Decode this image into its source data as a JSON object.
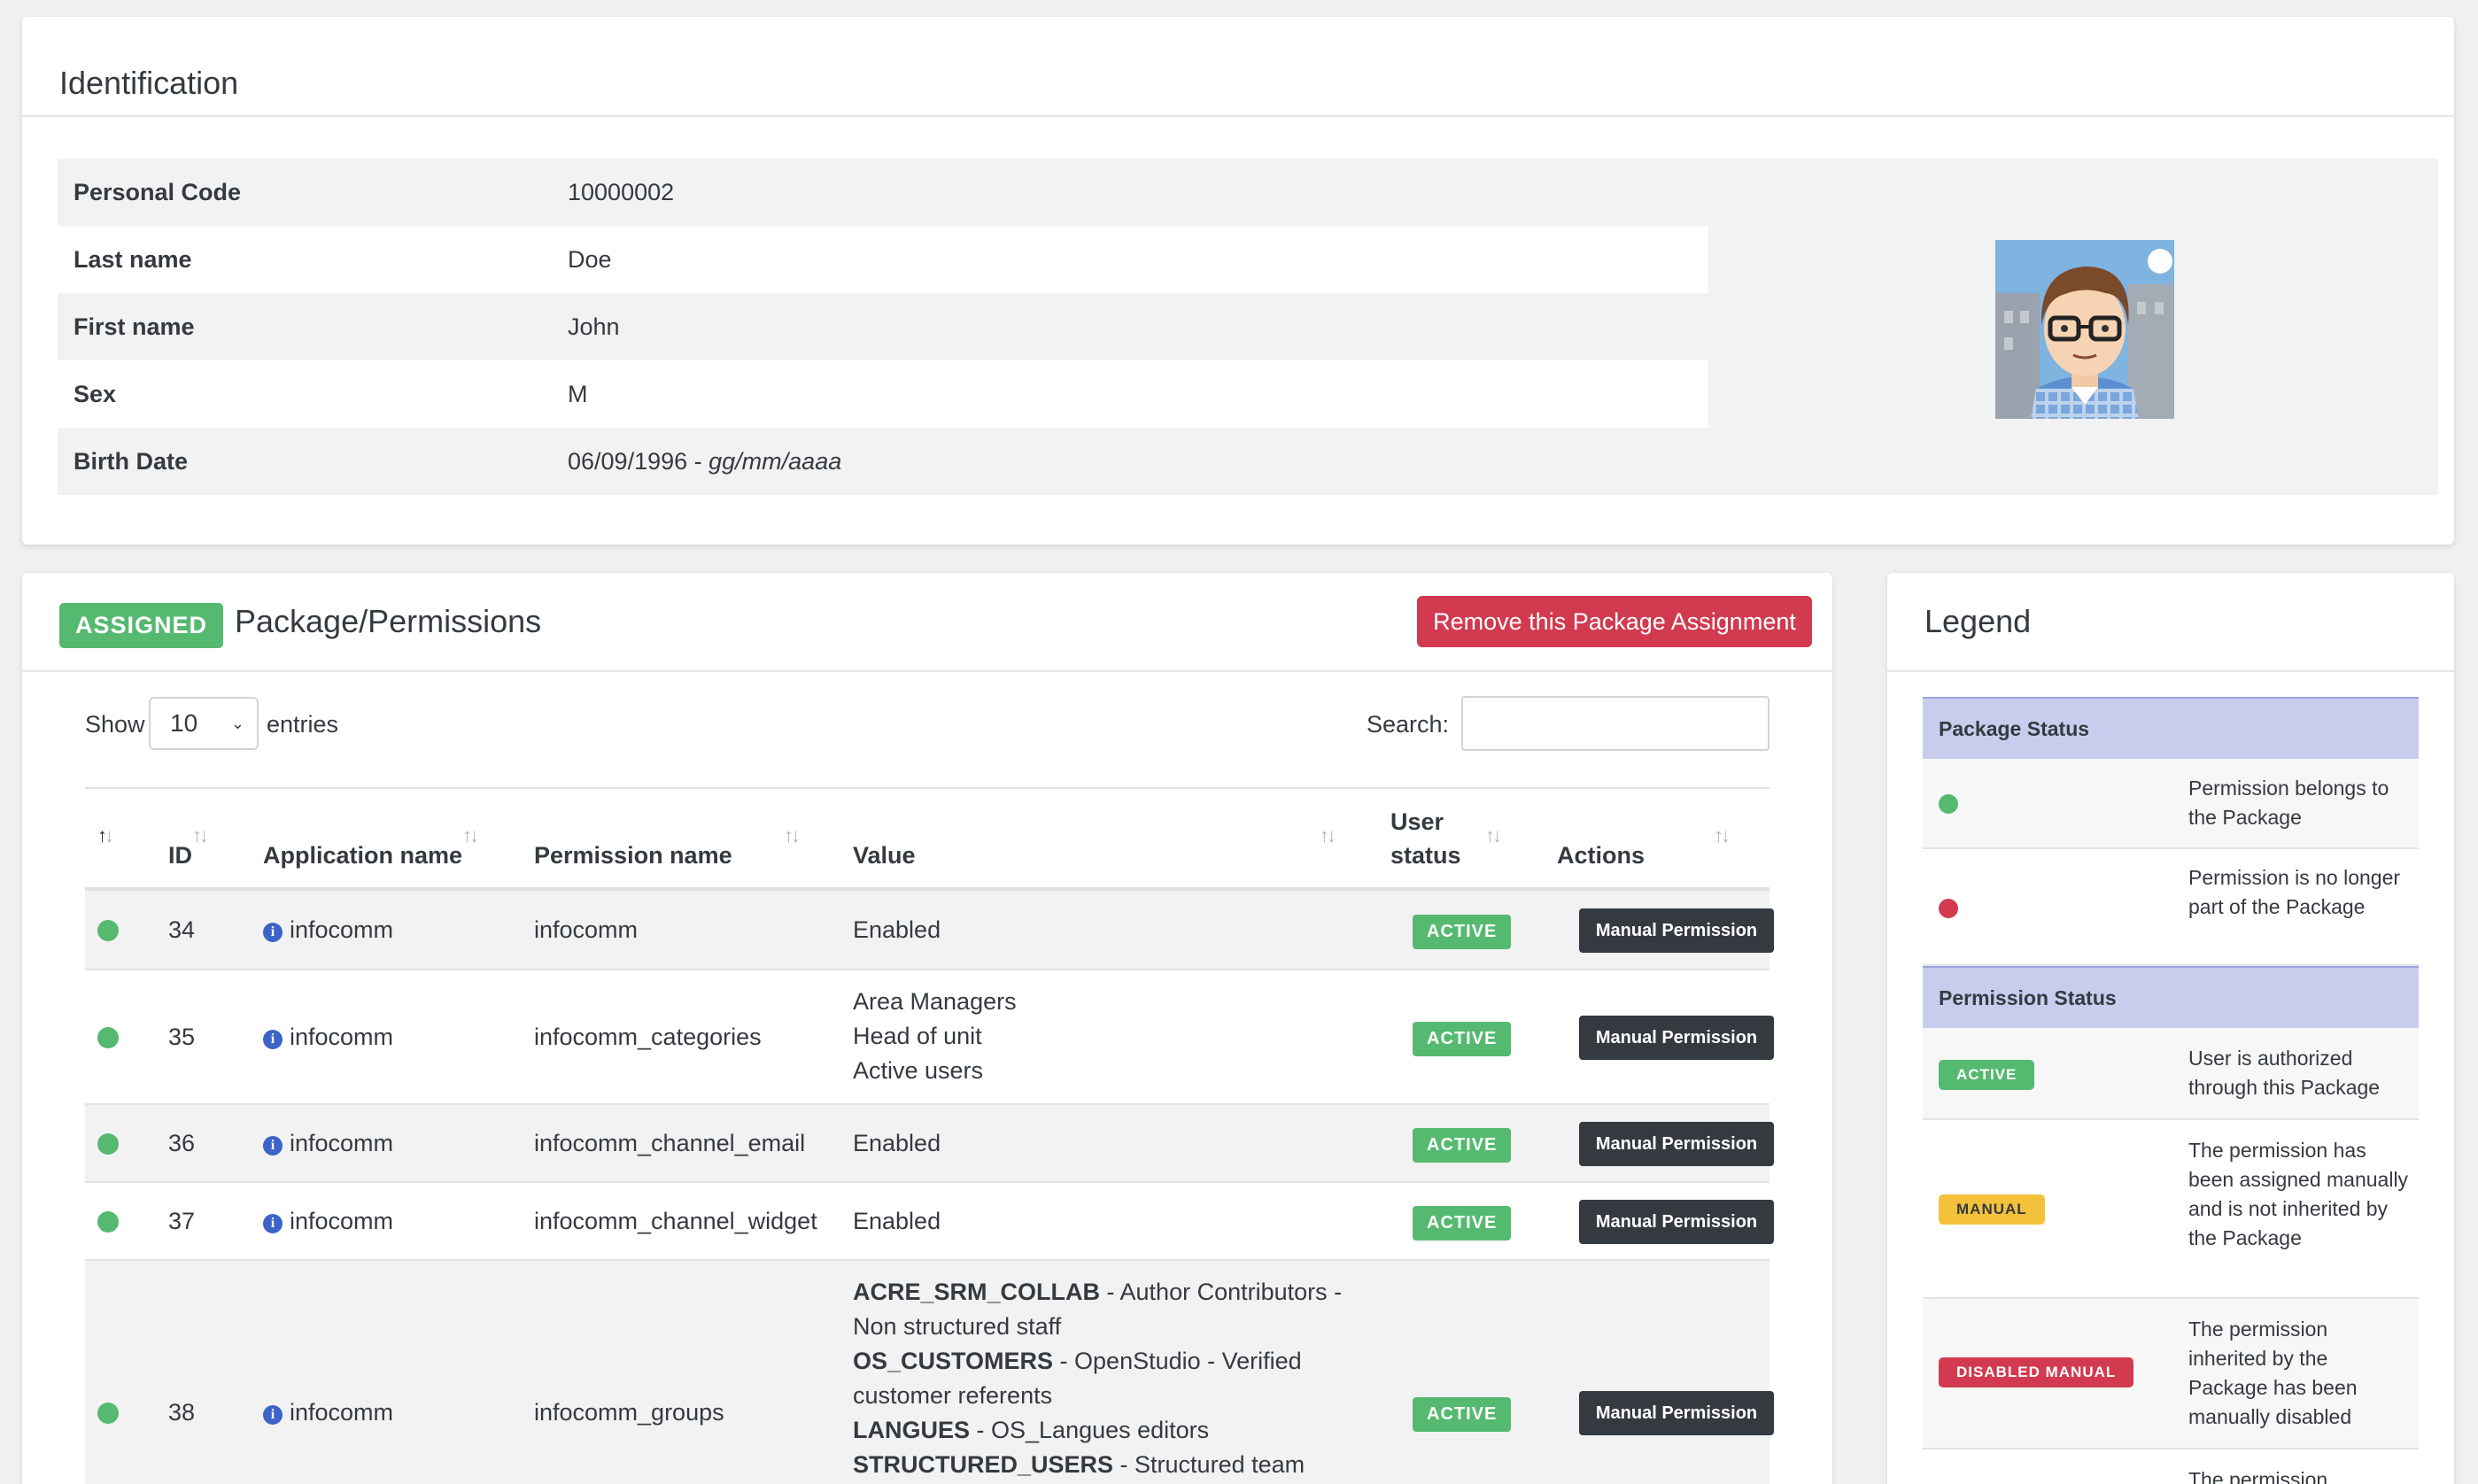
{
  "identification": {
    "title": "Identification",
    "rows": [
      {
        "label": "Personal Code",
        "value": "10000002"
      },
      {
        "label": "Last name",
        "value": "Doe"
      },
      {
        "label": "First name",
        "value": "John"
      },
      {
        "label": "Sex",
        "value": "M"
      },
      {
        "label": "Birth Date",
        "value": "06/09/1996 -",
        "format_hint": "gg/mm/aaaa"
      }
    ]
  },
  "package": {
    "status_badge": "ASSIGNED",
    "title": "Package/Permissions",
    "remove_button": "Remove this Package Assignment",
    "show_label": "Show",
    "entries_value": "10",
    "entries_label": "entries",
    "search_label": "Search:",
    "search_value": "",
    "columns": [
      "",
      "ID",
      "Application name",
      "Permission name",
      "Value",
      "User status",
      "Actions"
    ],
    "user_status_col_line1": "User",
    "user_status_col_line2": "status",
    "rows": [
      {
        "id": "34",
        "application": "infocomm",
        "permission": "infocomm",
        "value_lines": [
          "Enabled"
        ],
        "status": "ACTIVE",
        "action": "Manual Permission"
      },
      {
        "id": "35",
        "application": "infocomm",
        "permission": "infocomm_categories",
        "value_lines": [
          "Area Managers",
          "Head of unit",
          "Active users"
        ],
        "status": "ACTIVE",
        "action": "Manual Permission"
      },
      {
        "id": "36",
        "application": "infocomm",
        "permission": "infocomm_channel_email",
        "value_lines": [
          "Enabled"
        ],
        "status": "ACTIVE",
        "action": "Manual Permission"
      },
      {
        "id": "37",
        "application": "infocomm",
        "permission": "infocomm_channel_widget",
        "value_lines": [
          "Enabled"
        ],
        "status": "ACTIVE",
        "action": "Manual Permission"
      },
      {
        "id": "38",
        "application": "infocomm",
        "permission": "infocomm_groups",
        "value_groups": [
          {
            "code": "ACRE_SRM_COLLAB",
            "desc_line1": " - Author Contributors -",
            "desc_line2": "Non structured staff"
          },
          {
            "code": "OS_CUSTOMERS",
            "desc_line1": " - OpenStudio - Verified",
            "desc_line2": "customer referents"
          },
          {
            "code": "LANGUES",
            "desc_line1": " - OS_Langues editors",
            "desc_line2": ""
          },
          {
            "code": "STRUCTURED_USERS",
            "desc_line1": " - Structured team",
            "desc_line2": ""
          }
        ],
        "status": "ACTIVE",
        "action": "Manual Permission"
      }
    ]
  },
  "legend": {
    "title": "Legend",
    "package_status_header": "Package Status",
    "package_status_items": [
      {
        "color": "#55b96f",
        "desc": "Permission belongs to the Package"
      },
      {
        "color": "#d23a4f",
        "desc": "Permission is no longer part of the Package"
      }
    ],
    "permission_status_header": "Permission Status",
    "permission_status_items": [
      {
        "badge": "ACTIVE",
        "color": "#55b96f",
        "desc": "User is authorized through this Package"
      },
      {
        "badge": "MANUAL",
        "color": "#f3c13a",
        "desc": "The permission has been assigned manually and is not inherited by the Package"
      },
      {
        "badge": "DISABLED MANUAL",
        "color": "#d23a4f",
        "desc": "The permission inherited by the Package has been manually disabled"
      },
      {
        "badge": "",
        "color": "",
        "desc": "The permission"
      }
    ]
  },
  "colors": {
    "success": "#55b96f",
    "danger": "#d23a4f",
    "dark": "#343a40",
    "info": "#3d63c8",
    "legend_header": "#c8cdee"
  }
}
